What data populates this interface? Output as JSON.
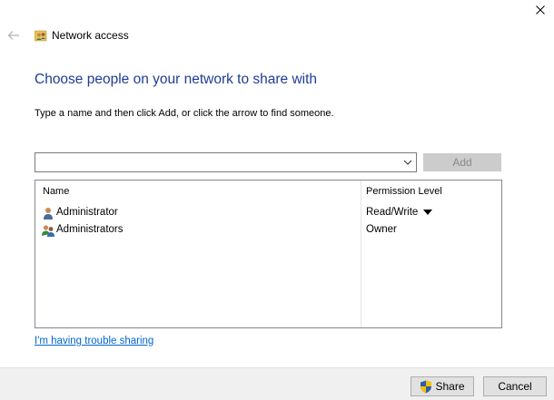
{
  "window": {
    "title": "Network access",
    "close_icon": "close-icon",
    "back_icon": "back-arrow-icon",
    "title_icon": "network-users-icon"
  },
  "main": {
    "heading": "Choose people on your network to share with",
    "instructions": "Type a name and then click Add, or click the arrow to find someone.",
    "name_input": {
      "value": "",
      "placeholder": ""
    },
    "add_label": "Add",
    "trouble_link": "I'm having trouble sharing"
  },
  "list": {
    "columns": [
      "Name",
      "Permission Level"
    ],
    "rows": [
      {
        "name": "Administrator",
        "permission": "Read/Write",
        "has_dropdown": true,
        "icon": "user-icon"
      },
      {
        "name": "Administrators",
        "permission": "Owner",
        "has_dropdown": false,
        "icon": "group-icon"
      }
    ]
  },
  "footer": {
    "share_label": "Share",
    "cancel_label": "Cancel",
    "share_icon": "uac-shield-icon"
  },
  "colors": {
    "heading": "#1e3c96",
    "link": "#0066cc",
    "footer_bg": "#f0f0f0",
    "disabled_button": "#cccccc"
  }
}
